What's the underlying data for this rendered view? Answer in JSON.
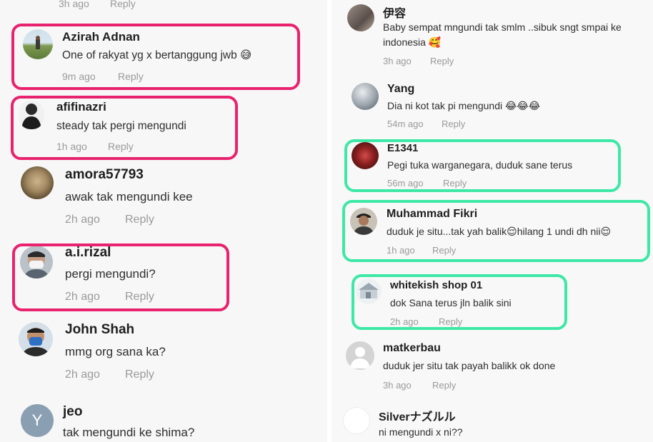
{
  "left": {
    "top_partial": {
      "time": "3h ago",
      "reply": "Reply"
    },
    "comments": [
      {
        "name": "Azirah Adnan",
        "text": "One of rakyat yg x bertanggung jwb 😅",
        "time": "9m ago",
        "reply": "Reply"
      },
      {
        "name": "afifinazri",
        "text": "steady tak pergi mengundi",
        "time": "1h ago",
        "reply": "Reply"
      },
      {
        "name": "amora57793",
        "text": "awak tak mengundi kee",
        "time": "2h ago",
        "reply": "Reply"
      },
      {
        "name": "a.i.rizal",
        "text": "pergi mengundi?",
        "time": "2h ago",
        "reply": "Reply"
      },
      {
        "name": "John Shah",
        "text": "mmg org sana ka?",
        "time": "2h ago",
        "reply": "Reply"
      },
      {
        "name": "jeo",
        "avatar_letter": "Y",
        "text": "tak mengundi ke shima?",
        "time": "",
        "reply": ""
      }
    ]
  },
  "right": {
    "comments": [
      {
        "name": "伊容",
        "text_line1": "Baby sempat mngundi tak smlm ..sibuk sngt smpai ke",
        "text_line2": "indonesia 🥰",
        "time": "3h ago",
        "reply": "Reply"
      },
      {
        "name": "Yang",
        "text": "Dia ni kot tak pi mengundi 😂😂😂",
        "time": "54m ago",
        "reply": "Reply"
      },
      {
        "name": "E1341",
        "text": "Pegi tuka warganegara, duduk sane terus",
        "time": "56m ago",
        "reply": "Reply"
      },
      {
        "name": "Muhammad Fikri",
        "text": "duduk je situ...tak yah balik😌hilang 1 undi dh nii😌",
        "time": "1h ago",
        "reply": "Reply"
      },
      {
        "name": "whitekish shop 01",
        "text": "dok Sana terus jln balik sini",
        "time": "2h ago",
        "reply": "Reply"
      },
      {
        "name": "matkerbau",
        "text": "duduk jer situ tak payah balikk ok done",
        "time": "3h ago",
        "reply": "Reply"
      },
      {
        "name": "Silverナズルル",
        "text": "ni mengundi x ni??",
        "time": "",
        "reply": ""
      }
    ]
  },
  "colors": {
    "highlight_pink": "#e8226e",
    "highlight_green": "#3de8a6",
    "meta_gray": "#9a9a9a"
  }
}
